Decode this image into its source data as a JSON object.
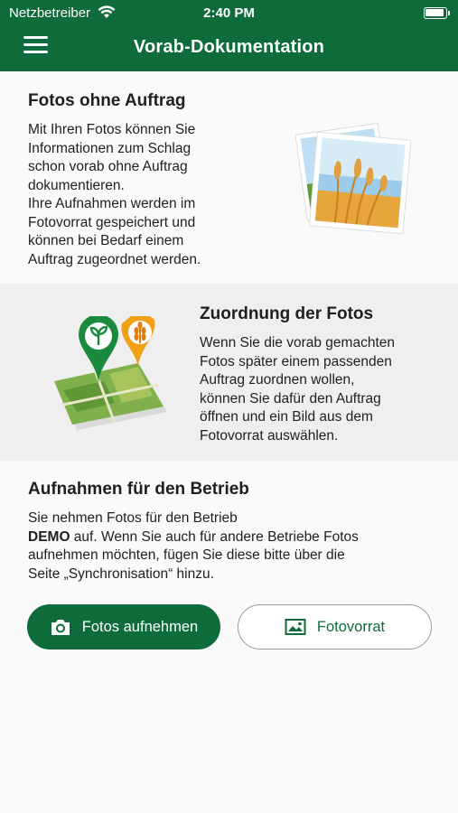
{
  "status_bar": {
    "carrier": "Netzbetreiber",
    "time": "2:40 PM"
  },
  "header": {
    "title": "Vorab-Dokumentation",
    "menu_icon": "hamburger-menu-icon"
  },
  "section_photos_without_order": {
    "title": "Fotos ohne Auftrag",
    "lines": [
      "Mit Ihren Fotos können Sie",
      "Informationen zum Schlag",
      "schon vorab ohne Auftrag",
      "dokumentieren.",
      "Ihre Aufnahmen werden im",
      "Fotovorrat gespeichert und",
      "können bei Bedarf einem",
      "Auftrag zugeordnet werden."
    ],
    "illustration": "photo-stack-wheat-icon"
  },
  "section_assignment": {
    "title": "Zuordnung der Fotos",
    "lines": [
      "Wenn Sie die vorab gemachten",
      "Fotos später einem passenden",
      "Auftrag zuordnen wollen,",
      "können Sie dafür den Auftrag",
      "öffnen und ein Bild aus dem",
      "Fotovorrat auswählen."
    ],
    "illustration": "map-pins-icon"
  },
  "section_company": {
    "title": "Aufnahmen für den Betrieb",
    "line1": "Sie nehmen Fotos für den Betrieb",
    "company_name": "DEMO",
    "line2_rest": " auf. Wenn Sie auch für andere  Betriebe Fotos",
    "line3": "aufnehmen möchten, fügen Sie diese bitte über die",
    "line4": "Seite „Synchronisation“ hinzu."
  },
  "buttons": {
    "take_photos": {
      "label": "Fotos aufnehmen",
      "icon": "camera-icon"
    },
    "photo_stock": {
      "label": "Fotovorrat",
      "icon": "image-icon"
    }
  },
  "colors": {
    "brand_green": "#0e6b3a",
    "grey_band": "#efefef"
  }
}
